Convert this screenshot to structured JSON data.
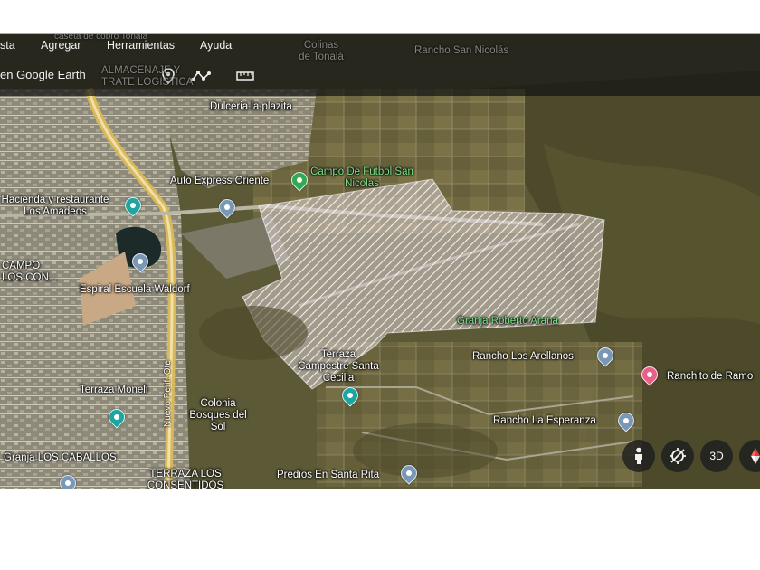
{
  "menu": {
    "items": [
      "sta",
      "Agregar",
      "Herramientas",
      "Ayuda"
    ]
  },
  "toolbar": {
    "text": "en Google Earth",
    "icons": [
      "place-pin-icon",
      "path-icon",
      "ruler-icon"
    ]
  },
  "map": {
    "labels": {
      "top_faint_1": "caseta de cobro Tonalá",
      "colinas": "Colinas de Tonalá",
      "rancho_san_nicolas": "Rancho San Nicolás",
      "almacenaje": "ALMACENAJE Y TRATE LOGISTICA",
      "dulceria": "Dulceria la plazita",
      "campo_futbol": "Campo De Futbol San Nicolas",
      "auto_express": "Auto Express Oriente",
      "hacienda": "Hacienda y restaurante Los Amadeos",
      "campo_los_con": "CAMPO LOS CON...",
      "espiral": "Espiral Escuela Waldorf",
      "granja_roberto": "Granja Roberto Arana",
      "terraza_santa": "Terraza Campestre Santa Cecilia",
      "rancho_arellanos": "Rancho Los Arellanos",
      "ranchito": "Ranchito de Ramo",
      "terraza_moneli": "Terraza Moneli",
      "colonia_bosques": "Colonia Bosques del Sol",
      "rancho_esperanza": "Rancho La Esperanza",
      "granja_caballos": "Granja LOS CABALLOS",
      "terraza_consentidos": "TERRAZA LOS CONSENTIDOS",
      "predios": "Predios En Santa Rita",
      "road": "Nuevo Perif. Ote"
    },
    "controls": {
      "street_view": "street-view-icon",
      "compass_reset": "orientation-icon",
      "three_d": "3D",
      "compass": "compass-icon"
    }
  },
  "colors": {
    "teal_line": "#6cc8d0",
    "overlay_bar": "#141414"
  }
}
